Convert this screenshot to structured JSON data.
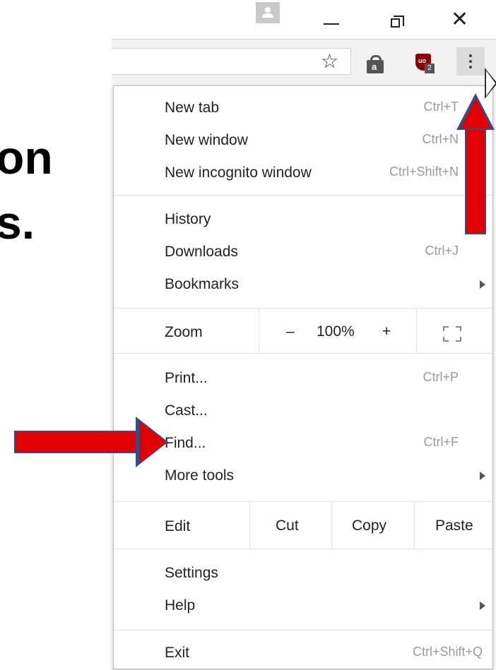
{
  "slide": {
    "line1": "on",
    "line2": "s."
  },
  "toolbar": {
    "star_icon": "☆",
    "ext1_icon": "shopping-bag-icon",
    "ext1_letter": "a",
    "ext2_icon": "ublock-shield-icon",
    "ext2_label": "uo",
    "ext2_badge": "2",
    "menu_icon": "three-dot-menu-icon"
  },
  "window": {
    "minimize_icon": "minimize-icon",
    "restore_icon": "restore-icon",
    "close_glyph": "✕"
  },
  "menu": {
    "new_tab": {
      "label": "New tab",
      "shortcut": "Ctrl+T"
    },
    "new_window": {
      "label": "New window",
      "shortcut": "Ctrl+N"
    },
    "new_incognito": {
      "label": "New incognito window",
      "shortcut": "Ctrl+Shift+N"
    },
    "history": {
      "label": "History"
    },
    "downloads": {
      "label": "Downloads",
      "shortcut": "Ctrl+J"
    },
    "bookmarks": {
      "label": "Bookmarks"
    },
    "zoom": {
      "label": "Zoom",
      "minus": "–",
      "value": "100%",
      "plus": "+"
    },
    "print": {
      "label": "Print...",
      "shortcut": "Ctrl+P"
    },
    "cast": {
      "label": "Cast..."
    },
    "find": {
      "label": "Find...",
      "shortcut": "Ctrl+F"
    },
    "more_tools": {
      "label": "More tools"
    },
    "edit": {
      "label": "Edit",
      "cut": "Cut",
      "copy": "Copy",
      "paste": "Paste"
    },
    "settings": {
      "label": "Settings"
    },
    "help": {
      "label": "Help"
    },
    "exit": {
      "label": "Exit",
      "shortcut": "Ctrl+Shift+Q"
    }
  },
  "annotations": {
    "arrow_color": "#e00000",
    "arrow_outline": "#2f4f8f"
  }
}
